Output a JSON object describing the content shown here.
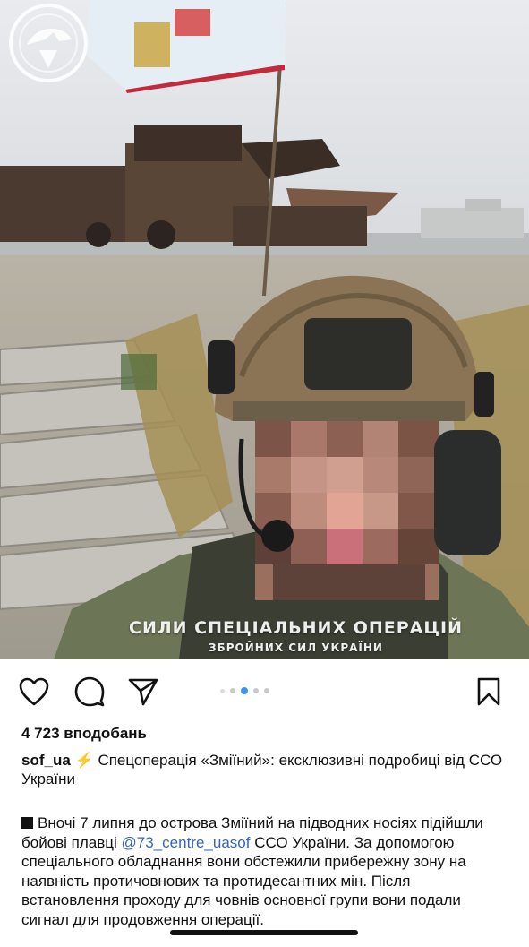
{
  "photo": {
    "alt_label": "post-photo",
    "caption_line1": "СИЛИ СПЕЦІАЛЬНИХ ОПЕРАЦІЙ",
    "caption_line2": "ЗБРОЙНИХ СИЛ УКРАЇНИ"
  },
  "actions": {
    "like_icon": "heart-icon",
    "comment_icon": "comment-icon",
    "share_icon": "send-icon",
    "save_icon": "bookmark-icon",
    "carousel": {
      "total": 5,
      "active_index": 2
    }
  },
  "post": {
    "likes": "4 723 вподобань",
    "username": "sof_ua",
    "caption_title": "Спецоперація «Зміїний»: ексклюзивні подробиці від ССО України",
    "body_before_mention": "Вночі 7 липня до острова Зміїний на підводних носіях підійшли бойові плавці",
    "mention": "@73_centre_uasof",
    "body_after_mention": " ССО України. За допомогою спеціального обладнання вони обстежили прибережну зону на наявність протичовнових та протидесантних мін. Після встановлення проходу для човнів основної групи вони подали сигнал для продовження операції."
  },
  "colors": {
    "mention": "#3566b8",
    "active_dot": "#3897f0",
    "bolt": "#f5b800"
  }
}
